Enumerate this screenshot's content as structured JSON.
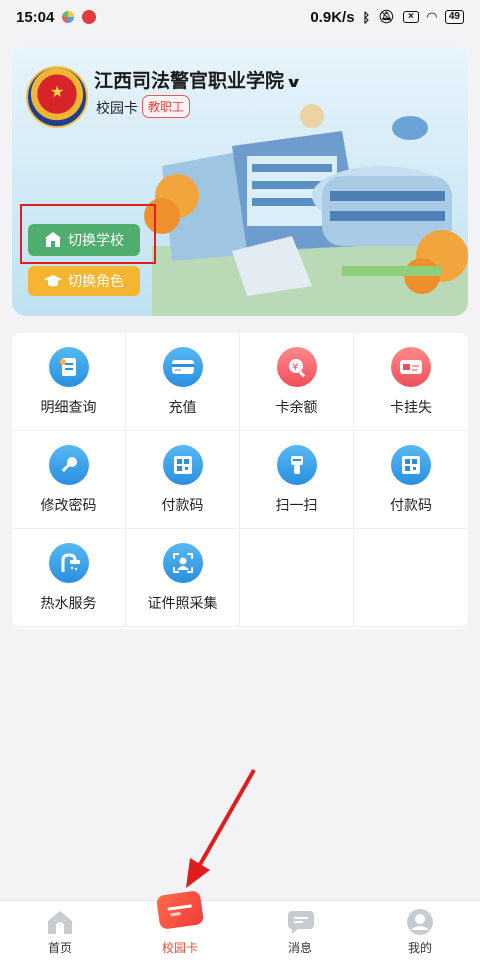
{
  "status_bar": {
    "time": "15:04",
    "network_speed": "0.9K/s",
    "battery": "49"
  },
  "banner": {
    "school_name": "江西司法警官职业学院",
    "card_label": "校园卡",
    "role_tag": "教职工",
    "switch_school_label": "切换学校",
    "switch_role_label": "切换角色"
  },
  "services": [
    {
      "label": "明细查询",
      "icon": "receipt-icon",
      "color": "blue"
    },
    {
      "label": "充值",
      "icon": "card-icon",
      "color": "blue"
    },
    {
      "label": "卡余额",
      "icon": "balance-search-icon",
      "color": "red"
    },
    {
      "label": "卡挂失",
      "icon": "lost-card-icon",
      "color": "red"
    },
    {
      "label": "修改密码",
      "icon": "key-icon",
      "color": "blue"
    },
    {
      "label": "付款码",
      "icon": "qr-code-icon",
      "color": "blue"
    },
    {
      "label": "扫一扫",
      "icon": "scanner-icon",
      "color": "blue"
    },
    {
      "label": "付款码",
      "icon": "qr-code-icon",
      "color": "blue"
    },
    {
      "label": "热水服务",
      "icon": "shower-icon",
      "color": "blue"
    },
    {
      "label": "证件照采集",
      "icon": "face-capture-icon",
      "color": "blue"
    }
  ],
  "bottom_nav": [
    {
      "label": "首页",
      "icon": "home-icon",
      "active": false
    },
    {
      "label": "校园卡",
      "icon": "campus-card-icon",
      "active": true
    },
    {
      "label": "消息",
      "icon": "message-icon",
      "active": false
    },
    {
      "label": "我的",
      "icon": "profile-icon",
      "active": false
    }
  ],
  "colors": {
    "accent": "#f04b3a",
    "green_button": "#4fae6e",
    "yellow_button": "#f6b530",
    "tile_blue": "#2a8fe0",
    "tile_red": "#f04e5b"
  }
}
